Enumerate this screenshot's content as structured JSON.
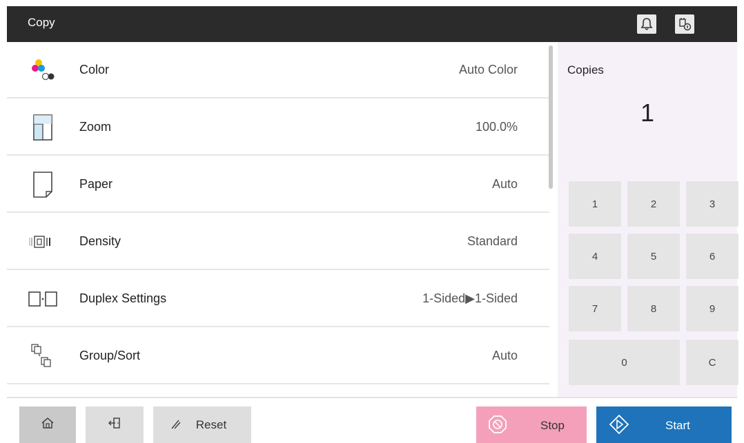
{
  "header": {
    "title": "Copy",
    "icons": [
      "bell-icon",
      "job-status-icon"
    ]
  },
  "settings": [
    {
      "label": "Color",
      "value": "Auto Color",
      "icon": "color-icon"
    },
    {
      "label": "Zoom",
      "value": "100.0%",
      "icon": "zoom-icon"
    },
    {
      "label": "Paper",
      "value": "Auto",
      "icon": "paper-icon"
    },
    {
      "label": "Density",
      "value": "Standard",
      "icon": "density-icon"
    },
    {
      "label": "Duplex Settings",
      "value": "1-Sided▶1-Sided",
      "icon": "duplex-icon"
    },
    {
      "label": "Group/Sort",
      "value": "Auto",
      "icon": "group-sort-icon"
    }
  ],
  "copies": {
    "label": "Copies",
    "value": "1"
  },
  "keypad": {
    "k1": "1",
    "k2": "2",
    "k3": "3",
    "k4": "4",
    "k5": "5",
    "k6": "6",
    "k7": "7",
    "k8": "8",
    "k9": "9",
    "k0": "0",
    "clear": "C"
  },
  "footer": {
    "reset_label": "Reset",
    "stop_label": "Stop",
    "start_label": "Start"
  },
  "colors": {
    "header_bg": "#2b2b2b",
    "stop_bg": "#f4a0bb",
    "start_bg": "#1e73ba",
    "keypad_bg": "#f6f1f8"
  }
}
